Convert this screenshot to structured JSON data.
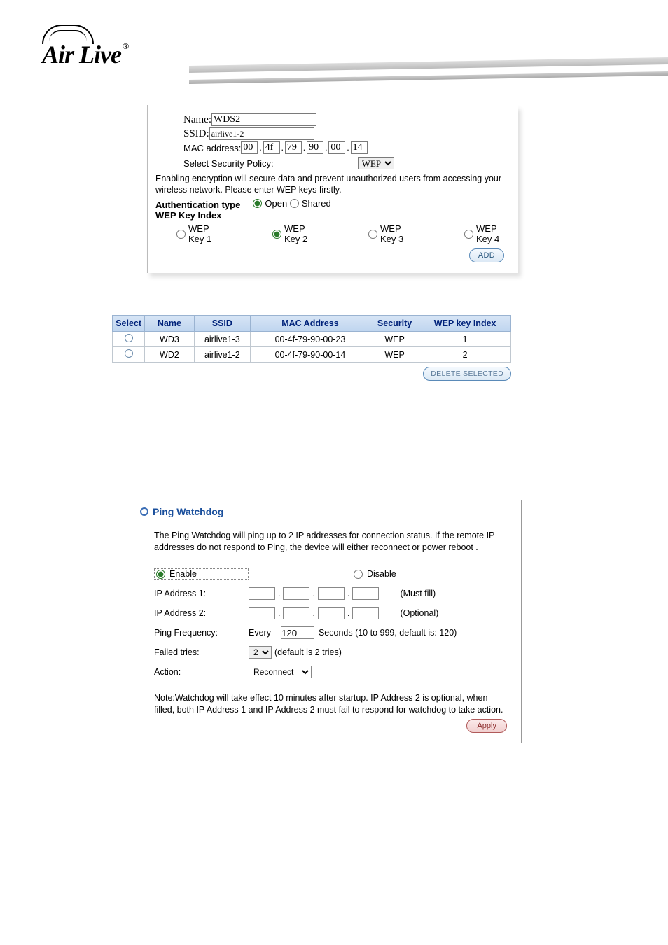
{
  "brand": "Air Live",
  "panel1": {
    "name_label": "Name:",
    "name_value": "WDS2",
    "ssid_label": "SSID:",
    "ssid_value": "airlive1-2",
    "mac_label": "MAC address:",
    "mac": [
      "00",
      "4f",
      "79",
      "90",
      "00",
      "14"
    ],
    "sec_policy_label": "Select Security Policy:",
    "sec_policy_value": "WEP",
    "note": "Enabling encryption will secure data and prevent unauthorized users from accessing your wireless network. Please enter WEP keys firstly.",
    "auth_label": "Authentication type",
    "auth_open": "Open",
    "auth_shared": "Shared",
    "wep_index_label": "WEP Key Index",
    "keys": [
      "WEP Key 1",
      "WEP Key 2",
      "WEP Key 3",
      "WEP Key 4"
    ],
    "add_btn": "ADD"
  },
  "table": {
    "headers": [
      "Select",
      "Name",
      "SSID",
      "MAC Address",
      "Security",
      "WEP key Index"
    ],
    "rows": [
      {
        "name": "WD3",
        "ssid": "airlive1-3",
        "mac": "00-4f-79-90-00-23",
        "sec": "WEP",
        "idx": "1"
      },
      {
        "name": "WD2",
        "ssid": "airlive1-2",
        "mac": "00-4f-79-90-00-14",
        "sec": "WEP",
        "idx": "2"
      }
    ],
    "delete_btn": "DELETE SELECTED"
  },
  "panel2": {
    "title": "Ping Watchdog",
    "desc": "The Ping Watchdog will ping up to 2 IP addresses for connection status. If the remote IP addresses do not respond to Ping, the device will either reconnect or power reboot .",
    "enable": "Enable",
    "disable": "Disable",
    "ip1_label": "IP Address 1:",
    "ip1_hint": "(Must fill)",
    "ip2_label": "IP Address 2:",
    "ip2_hint": "(Optional)",
    "pf_label": "Ping Frequency:",
    "pf_every": "Every",
    "pf_value": "120",
    "pf_hint": "Seconds (10 to 999, default is: 120)",
    "ft_label": "Failed tries:",
    "ft_value": "2",
    "ft_hint": "(default is 2 tries)",
    "action_label": "Action:",
    "action_value": "Reconnect",
    "note": "Note:Watchdog will take effect 10 minutes after startup. IP Address 2 is optional, when filled, both IP Address 1 and IP Address 2 must fail to respond for watchdog to take action.",
    "apply_btn": "Apply"
  }
}
